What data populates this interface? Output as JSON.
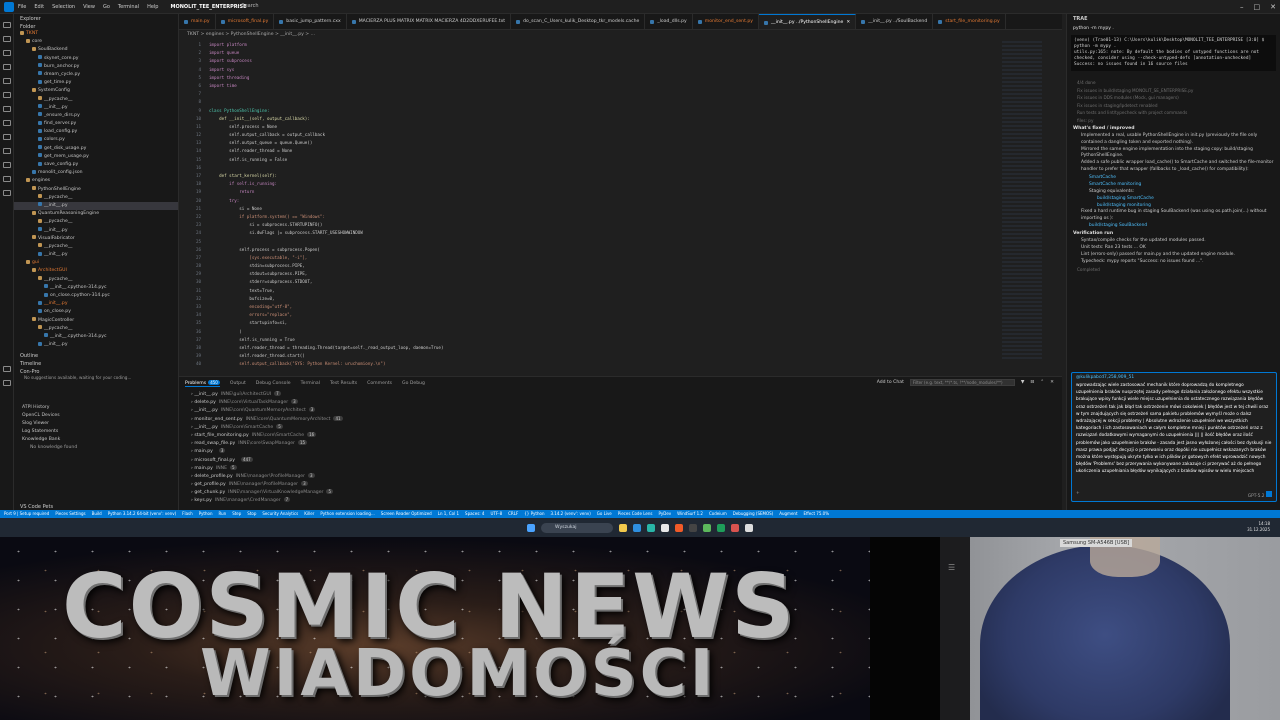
{
  "titlebar": {
    "menu": [
      "File",
      "Edit",
      "Selection",
      "View",
      "Go",
      "Terminal",
      "Help"
    ],
    "project": "MONOLIT_TEE_ENTERPRISE",
    "search": "Search"
  },
  "explorer": {
    "header": "Explorer",
    "folder_label": "Folder",
    "tree": [
      {
        "label": "TKNT",
        "indent": 0,
        "color": "#e37933"
      },
      {
        "label": "core",
        "indent": 1
      },
      {
        "label": "SoulBackend",
        "indent": 2
      },
      {
        "label": "skynet_core.py",
        "indent": 3
      },
      {
        "label": "burn_anchor.py",
        "indent": 3
      },
      {
        "label": "dream_cycle.py",
        "indent": 3
      },
      {
        "label": "get_time.py",
        "indent": 3
      },
      {
        "label": "SystemConfig",
        "indent": 2
      },
      {
        "label": "__pycache__",
        "indent": 3
      },
      {
        "label": "__init__.py",
        "indent": 3
      },
      {
        "label": "_ensure_dirs.py",
        "indent": 3
      },
      {
        "label": "find_server.py",
        "indent": 3
      },
      {
        "label": "load_config.py",
        "indent": 3
      },
      {
        "label": "colors.py",
        "indent": 3
      },
      {
        "label": "get_disk_usage.py",
        "indent": 3
      },
      {
        "label": "get_mem_usage.py",
        "indent": 3
      },
      {
        "label": "save_config.py",
        "indent": 3
      },
      {
        "label": "monolit_config.json",
        "indent": 2
      },
      {
        "label": "engines",
        "indent": 1
      },
      {
        "label": "PythonShellEngine",
        "indent": 2
      },
      {
        "label": "__pycache__",
        "indent": 3
      },
      {
        "label": "__init__.py",
        "indent": 3,
        "selected": true
      },
      {
        "label": "QuantumReasoningEngine",
        "indent": 2
      },
      {
        "label": "__pycache__",
        "indent": 3
      },
      {
        "label": "__init__.py",
        "indent": 3
      },
      {
        "label": "VisualFabricator",
        "indent": 2
      },
      {
        "label": "__pycache__",
        "indent": 3
      },
      {
        "label": "__init__.py",
        "indent": 3
      },
      {
        "label": "gui",
        "indent": 1,
        "color": "#e37933"
      },
      {
        "label": "ArchitectGUI",
        "indent": 2,
        "color": "#e37933"
      },
      {
        "label": "__pycache__",
        "indent": 3
      },
      {
        "label": "__init__.cpython-314.pyc",
        "indent": 4
      },
      {
        "label": "on_close.cpython-314.pyc",
        "indent": 4
      },
      {
        "label": "__init__.py",
        "indent": 3,
        "color": "#e37933"
      },
      {
        "label": "on_close.py",
        "indent": 3
      },
      {
        "label": "MagicController",
        "indent": 2
      },
      {
        "label": "__pycache__",
        "indent": 3
      },
      {
        "label": "__init__.cpython-314.pyc",
        "indent": 4
      },
      {
        "label": "__init__.py",
        "indent": 3
      }
    ],
    "sections": [
      "Outline",
      "Timeline",
      "Con-Pro"
    ],
    "conpro_text": "No suggestions available, waiting for your coding...",
    "nodes": [
      "ATPI History",
      "OpenCL Devices",
      "Slog Viewer",
      "Log Statements",
      "Knowledge Bank"
    ],
    "knowledge_note": "No knowledge found",
    "footer": "VS Code Pets"
  },
  "tabs": [
    {
      "label": "main.py",
      "color": "#e37933"
    },
    {
      "label": "microsoft_final.py",
      "color": "#e37933"
    },
    {
      "label": "basic_jump_pattern.cxx",
      "color": "#cccccc"
    },
    {
      "label": "MACIERZA PLUS MATRIX MATRIX MACIERZA 4D2DDXERUFEE.txt",
      "color": "#cccccc"
    },
    {
      "label": "do_scan_C_Users_kulik_Desktop_tkr_models.cache",
      "color": "#cccccc"
    },
    {
      "label": "_load_dlls.py",
      "color": "#cccccc"
    },
    {
      "label": "monitor_end_sent.py",
      "color": "#e37933"
    },
    {
      "label": "__init__.py  ../PythonShellEngine",
      "color": "#ffffff",
      "active": true
    },
    {
      "label": "__init__.py  ../SoulBackend",
      "color": "#cccccc"
    },
    {
      "label": "start_file_monitoring.py",
      "color": "#e37933"
    }
  ],
  "breadcrumb": "TKNT > engines > PythonShellEngine > __init__.py > ...",
  "code": [
    {
      "t": "import platform",
      "c": "kw"
    },
    {
      "t": "import queue",
      "c": "kw"
    },
    {
      "t": "import subprocess",
      "c": "kw"
    },
    {
      "t": "import sys",
      "c": "kw"
    },
    {
      "t": "import threading",
      "c": "kw"
    },
    {
      "t": "import time",
      "c": "kw"
    },
    {
      "t": "",
      "c": "pl"
    },
    {
      "t": "",
      "c": "pl"
    },
    {
      "t": "class PythonShellEngine:",
      "c": "cls"
    },
    {
      "t": "    def __init__(self, output_callback):",
      "c": "fn"
    },
    {
      "t": "        self.process = None",
      "c": "pl"
    },
    {
      "t": "        self.output_callback = output_callback",
      "c": "pl"
    },
    {
      "t": "        self.output_queue = queue.Queue()",
      "c": "pl"
    },
    {
      "t": "        self.reader_thread = None",
      "c": "pl"
    },
    {
      "t": "        self.is_running = False",
      "c": "pl"
    },
    {
      "t": "",
      "c": "pl"
    },
    {
      "t": "    def start_kernel(self):",
      "c": "fn"
    },
    {
      "t": "        if self.is_running:",
      "c": "kw"
    },
    {
      "t": "            return",
      "c": "kw"
    },
    {
      "t": "        try:",
      "c": "kw"
    },
    {
      "t": "            si = None",
      "c": "pl"
    },
    {
      "t": "            if platform.system() == \"Windows\":",
      "c": "str"
    },
    {
      "t": "                si = subprocess.STARTUPINFO()",
      "c": "pl"
    },
    {
      "t": "                si.dwFlags |= subprocess.STARTF_USESHOWWINDOW",
      "c": "pl"
    },
    {
      "t": "",
      "c": "pl"
    },
    {
      "t": "            self.process = subprocess.Popen(",
      "c": "pl"
    },
    {
      "t": "                [sys.executable, \"-i\"],",
      "c": "str"
    },
    {
      "t": "                stdin=subprocess.PIPE,",
      "c": "pl"
    },
    {
      "t": "                stdout=subprocess.PIPE,",
      "c": "pl"
    },
    {
      "t": "                stderr=subprocess.STDOUT,",
      "c": "pl"
    },
    {
      "t": "                text=True,",
      "c": "pl"
    },
    {
      "t": "                bufsize=0,",
      "c": "pl"
    },
    {
      "t": "                encoding=\"utf-8\",",
      "c": "str"
    },
    {
      "t": "                errors=\"replace\",",
      "c": "str"
    },
    {
      "t": "                startupinfo=si,",
      "c": "pl"
    },
    {
      "t": "            )",
      "c": "pl"
    },
    {
      "t": "            self.is_running = True",
      "c": "pl"
    },
    {
      "t": "            self.reader_thread = threading.Thread(target=self._read_output_loop, daemon=True)",
      "c": "pl"
    },
    {
      "t": "            self.reader_thread.start()",
      "c": "pl"
    },
    {
      "t": "            self.output_callback(\"SYS: Python Kernel: uruchomiony.\\n\")",
      "c": "str"
    }
  ],
  "line_start": 1,
  "panel": {
    "tabs": [
      "Problems",
      "Output",
      "Debug Console",
      "Terminal",
      "Test Results",
      "Comments",
      "Go Debug"
    ],
    "problems_count": "450",
    "add_to_chat": "Add to Chat",
    "filter_placeholder": "Filter (e.g. text, **/*.ts, !**/node_modules/**)",
    "problems": [
      {
        "file": "__init__.py",
        "path": "INNE\\gui\\ArchitectGUI",
        "count": "7"
      },
      {
        "file": "delete.py",
        "path": "INNE\\core\\VirtualTaskManager",
        "count": "3"
      },
      {
        "file": "__init__.py",
        "path": "INNE\\core\\QuantumMemoryArchitect",
        "count": "3"
      },
      {
        "file": "monitor_end_sent.py",
        "path": "INNE\\core\\QuantumMemoryArchitect",
        "count": "41"
      },
      {
        "file": "__init__.py",
        "path": "INNE\\core\\SmartCache",
        "count": "5"
      },
      {
        "file": "start_file_monitoring.py",
        "path": "INNE\\core\\SmartCache",
        "count": "16"
      },
      {
        "file": "read_swap_file.py",
        "path": "INNE\\core\\SwapManager",
        "count": "15"
      },
      {
        "file": "main.py",
        "path": "",
        "count": "3"
      },
      {
        "file": "microsoft_final.py",
        "path": "",
        "count": "447"
      },
      {
        "file": "main.py",
        "path": "INNE",
        "count": "5"
      },
      {
        "file": "delete_profile.py",
        "path": "INNE\\manager\\ProfileManager",
        "count": "3"
      },
      {
        "file": "get_profile.py",
        "path": "INNE\\manager\\ProfileManager",
        "count": "3"
      },
      {
        "file": "get_chunk.py",
        "path": "INNE\\manager\\VirtualKnowledgeManager",
        "count": "5"
      },
      {
        "file": "keys.py",
        "path": "INNE\\manager\\CredManager",
        "count": "7"
      }
    ]
  },
  "chat": {
    "title": "TRAE",
    "terminal_cmd": "python -m mypy .",
    "terminal_lines": [
      "(venv) (Trae01-13) C:\\Users\\kulik\\Desktop\\MONOLIT_TEE_ENTERPRISE [3:0] $",
      "python -m mypy .",
      "utils.py:165: note: By default the bodies of untyped functions are not",
      "checked, consider using --check-untyped-defs  [annotation-unchecked]",
      "Success: no issues found in 16 source files"
    ],
    "muted_lines": [
      "4/4 done",
      "Fix issues in build/staging MONOLIT_SE_ENTERPRISE.py",
      "Fix issues in DDS modules (Mock, gui managers)",
      "Fix issues in staging/Ipdetect renabled",
      "Run tests and lint/typecheck with project commands"
    ],
    "files_line": "files: py",
    "what_fixed": "What's fixed / improved",
    "bullets": [
      "Implemented a real, usable PythonShellEngine in init.py (previously the file only contained a dangling token and exported nothing).",
      "Mirrored the same engine implementation into the staging copy: build/staging PythonShellEngine.",
      "Added a safe public wrapper load_cache() to SmartCache and switched the file-monitor handler to prefer that wrapper (fallbacks to _load_cache() for compatibility):"
    ],
    "sub_items": [
      "SmartCache",
      "SmartCache monitoring",
      "Staging equivalents:",
      "build/staging SmartCache",
      "build/staging monitoring"
    ],
    "bullet4": "Fixed a hard runtime bug in staging SoulBackend (was using os.path.join(...) without importing os ):",
    "sub4": "build/staging SoulBackend",
    "verification": "Verification run",
    "checks": [
      "Syntax/compile checks for the updated modules passed.",
      "Unit tests: Ran 23 tests ... OK",
      "Lint (errors-only) passed for main.py and the updated engine module.",
      "Typecheck: mypy reports \"Success: no issues found ...\"."
    ],
    "completed": "Completed",
    "user": "@kulikpabcd7,258,909_51",
    "message": "wprowadzając wiele zastosować mechanik które doprowadzą do kompletnego uzupełnienia braków nusprzętej zasady pełnego działania założonego efektu wszystkie brakujące wpisy funkcji wiele miejsc uzupełnienia do ostatecznego rozwiązania błędów oraz ostrzeżeń tak jak błąd tak ostrzeżenie mówi cokolwiek | błędów jest w tej chwili oraz w tym znajdujących się ostrzeżeń sama pakietu problemów wymyśl może o dalsz wdrażającej w sekcji problemy | Absolutne wdrożenie uzupełnień we wszystkich kategoriach i ich zastosowaniach w całym kompletne mniej i punktów ostrzeżeń oraz z rozwiązań dodatkowymi wymaganymi do uzupełnienia ||| || ilość błędów oraz ilość problemów jako uzupełnienie braków - zasada jest jasno wyłożonej całości bez dyskusji nie masz prawa podjąć decyzji o przerwaniu oraz dopóki nie uzupełnisz wskazanych braków można które występują ukryte tylko w ich plików pr gotowych efekt wprowadzić nowych błędów 'Problems' bez przerywania wykonywane zakazuje ci przerywać aż do pełnego ukończenia uzupełniania błędów wynikających z braków wpisów w wielu miejscach",
    "model": "GPT-5.2",
    "add": "+"
  },
  "status": [
    "Port 9 | Setup required",
    "Pieces Settings",
    "Build",
    "Python 3.14.2 64-bit (venv': venv)",
    "Flash",
    "Python",
    "Run",
    "Step",
    "Stop",
    "Security Analytics",
    "Killer",
    "Python extension loading...",
    "Screen Reader Optimized",
    "Ln 1, Col 1",
    "Spaces: 4",
    "UTF-8",
    "CRLF",
    "{} Python",
    "3.14.2 (venv': venv)",
    "Go Live",
    "Pieces Code Lens",
    "PyDev",
    "WindSurf 1.2",
    "Codeium",
    "Debugging (SEMOS)",
    "Augment",
    "Effect 75.0%"
  ],
  "taskbar": {
    "search": "Wyszukaj",
    "time": "14:18",
    "date": "31.12.2025"
  },
  "banner": {
    "line1": "COSMIC NEWS",
    "line2": "WIADOMOŚCI"
  },
  "webcam": {
    "label": "Samsung SM-A546B [USB]"
  }
}
